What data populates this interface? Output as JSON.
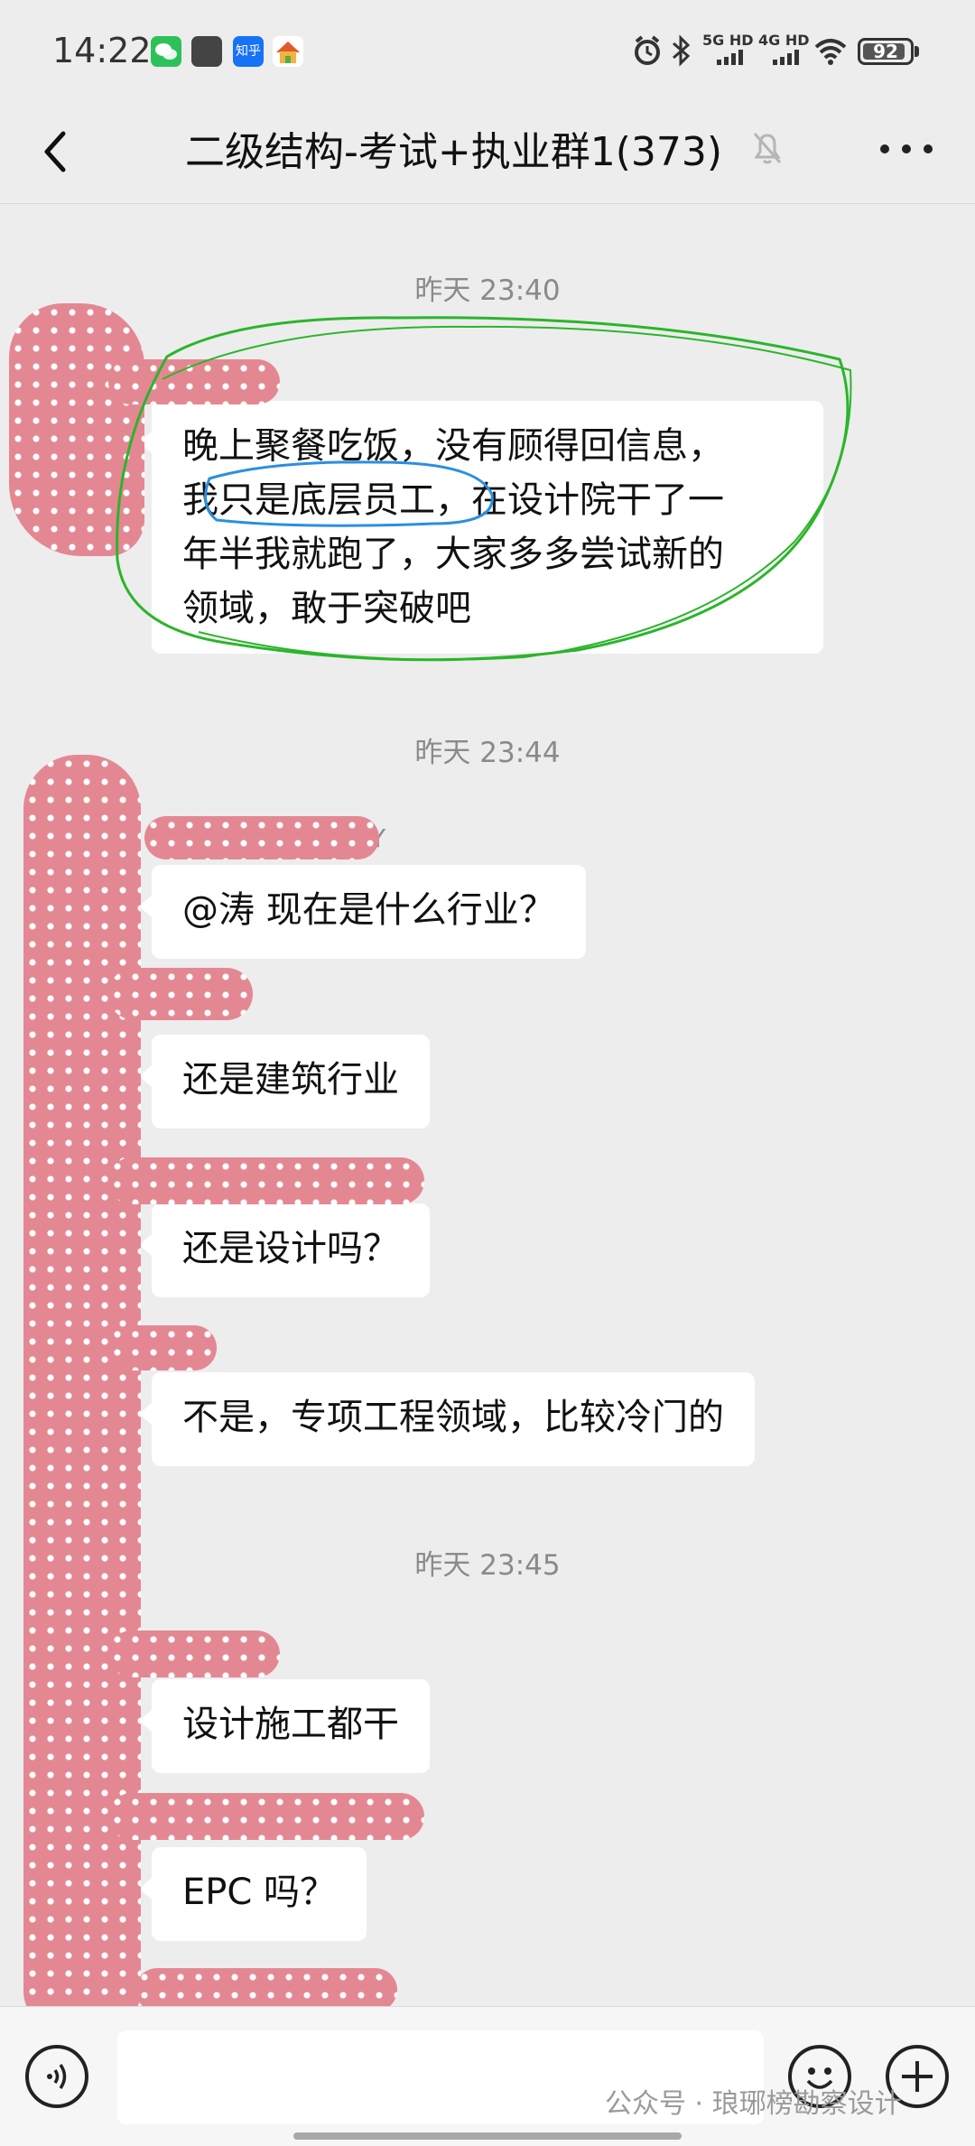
{
  "status_bar": {
    "time": "14:22",
    "app_icons": [
      "wechat-icon",
      "gallery-icon",
      "zhihu-icon",
      "home-app-icon"
    ],
    "zhihu_label": "知乎",
    "network_1": "5G HD",
    "network_2": "4G HD",
    "battery": "92",
    "battery_level": 0.92
  },
  "header": {
    "title": "二级结构-考试+执业群1(373)",
    "muted": true
  },
  "messages": [
    {
      "type": "time",
      "text": "昨天 23:40"
    },
    {
      "type": "msg",
      "text": "晚上聚餐吃饭，没有顾得回信息，\n我只是底层员工，在设计院干了一\n年半我就跑了，大家多多尝试新的\n领域，敢于突破吧"
    },
    {
      "type": "time",
      "text": "昨天 23:44"
    },
    {
      "type": "msg",
      "nickname_visible": "Y",
      "text": "@涛  现在是什么行业？"
    },
    {
      "type": "msg",
      "text": "还是建筑行业"
    },
    {
      "type": "msg",
      "text": "还是设计吗？"
    },
    {
      "type": "msg",
      "text": "不是，专项工程领域，比较冷门的"
    },
    {
      "type": "time",
      "text": "昨天 23:45"
    },
    {
      "type": "msg",
      "text": "设计施工都干"
    },
    {
      "type": "msg",
      "text": "EPC 吗？"
    }
  ],
  "input_bar": {
    "placeholder": "",
    "watermark": "公众号 · 琅琊榜勘察设计"
  },
  "colors": {
    "background": "#ededed",
    "bubble": "#ffffff",
    "redaction": "#e38893",
    "annotation_green": "#2bb52b",
    "annotation_blue": "#2a8fe0"
  }
}
